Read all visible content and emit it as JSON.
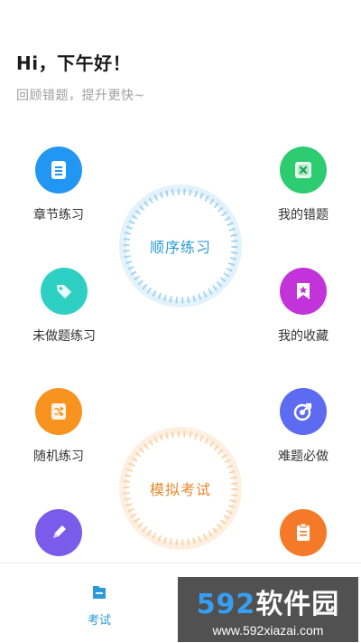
{
  "header": {
    "greeting": "Hi，下午好！",
    "subtitle": "回顾错题，提升更快~"
  },
  "features": {
    "chapter": {
      "label": "章节练习",
      "icon": "document-icon",
      "color": "#2196f3"
    },
    "wrong": {
      "label": "我的错题",
      "icon": "error-book-icon",
      "color": "#2ecc71"
    },
    "undone": {
      "label": "未做题练习",
      "icon": "tag-icon",
      "color": "#2ed0c4"
    },
    "favorites": {
      "label": "我的收藏",
      "icon": "bookmark-star-icon",
      "color": "#c233d9"
    },
    "random": {
      "label": "随机练习",
      "icon": "shuffle-icon",
      "color": "#f7931e"
    },
    "hard": {
      "label": "难题必做",
      "icon": "target-icon",
      "color": "#5c6bef"
    },
    "pen": {
      "label": "",
      "icon": "pen-icon",
      "color": "#7b5bea"
    },
    "clipboard": {
      "label": "",
      "icon": "clipboard-icon",
      "color": "#f47a2a"
    }
  },
  "rings": {
    "sequential": {
      "label": "顺序练习",
      "color": "#2a9bd8"
    },
    "mock_exam": {
      "label": "模拟考试",
      "color": "#e8882d"
    }
  },
  "tabbar": {
    "exam": {
      "label": "考试",
      "color": "#2a9bd8"
    }
  },
  "watermark": {
    "brand_num": "592",
    "brand_text": "软件园",
    "url": "www.592xiazai.com"
  }
}
